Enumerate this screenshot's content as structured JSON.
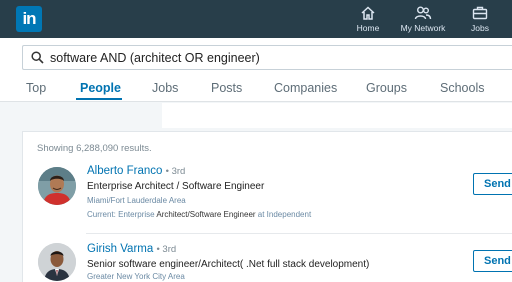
{
  "topbar": {
    "logo_text": "in",
    "nav": [
      {
        "label": "Home",
        "icon": "home-icon"
      },
      {
        "label": "My Network",
        "icon": "network-icon"
      },
      {
        "label": "Jobs",
        "icon": "briefcase-icon"
      }
    ]
  },
  "search": {
    "query": "software AND (architect OR engineer)"
  },
  "tabs": [
    {
      "label": "Top",
      "active": false
    },
    {
      "label": "People",
      "active": true
    },
    {
      "label": "Jobs",
      "active": false
    },
    {
      "label": "Posts",
      "active": false
    },
    {
      "label": "Companies",
      "active": false
    },
    {
      "label": "Groups",
      "active": false
    },
    {
      "label": "Schools",
      "active": false
    }
  ],
  "results": {
    "summary": "Showing 6,288,090 results.",
    "people": [
      {
        "name": "Alberto Franco",
        "degree": "• 3rd",
        "title": "Enterprise Architect / Software Engineer",
        "location": "Miami/Fort Lauderdale Area",
        "current_prefix": "Current: Enterprise ",
        "current_hl1": "Architect",
        "current_sep": "/",
        "current_hl2": "Software Engineer",
        "current_suffix": " at Independent",
        "action": "Send"
      },
      {
        "name": "Girish Varma",
        "degree": "• 3rd",
        "title": "Senior software engineer/Architect( .Net full stack development)",
        "location": "Greater New York City Area",
        "action": "Send"
      }
    ]
  },
  "colors": {
    "brand": "#0073b1",
    "topbar": "#283e4a"
  }
}
